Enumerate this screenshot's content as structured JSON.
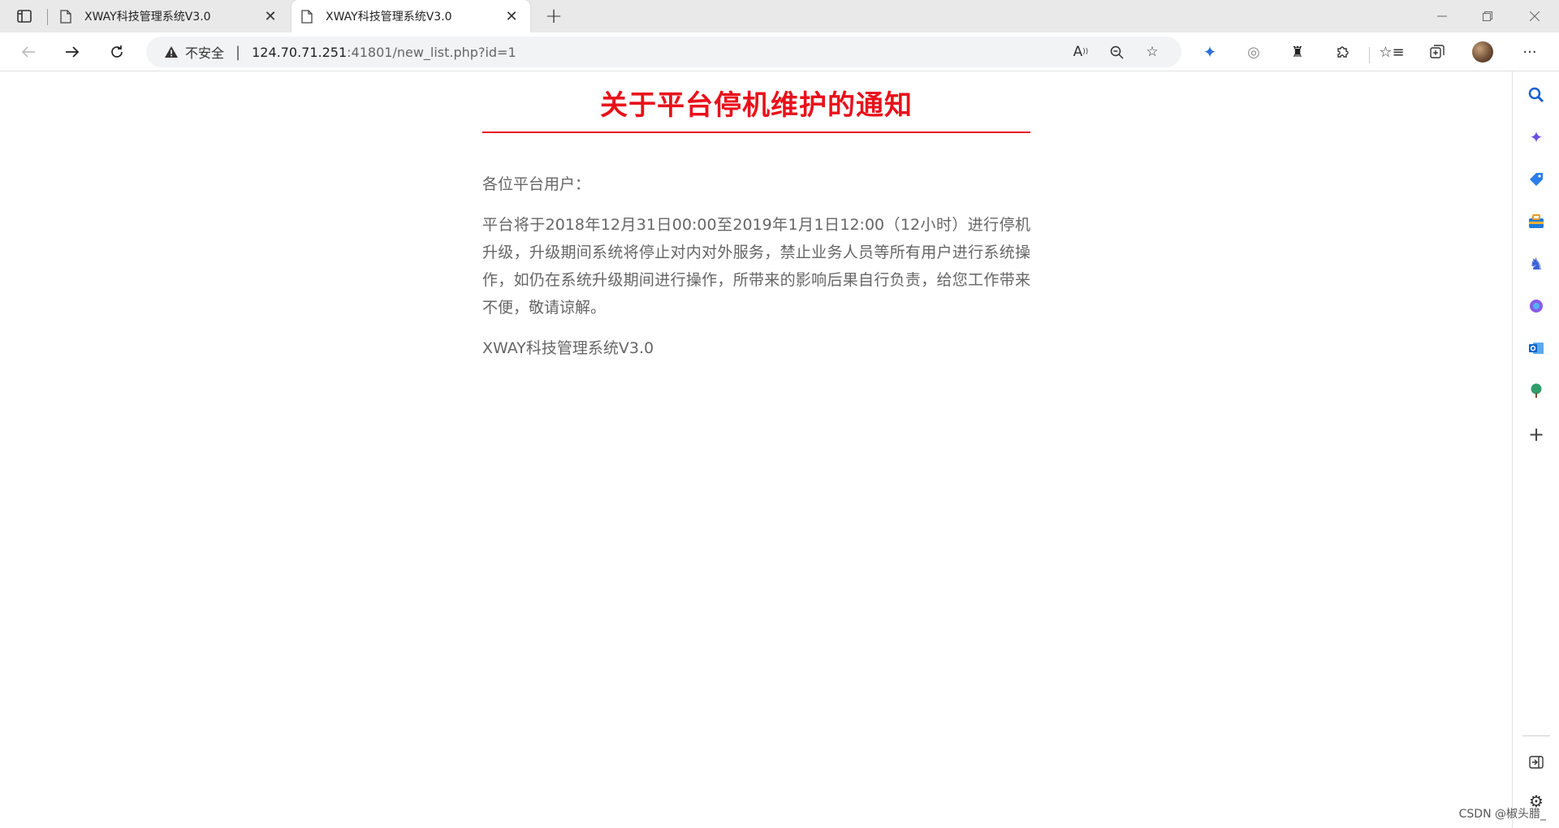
{
  "browser": {
    "tabs": [
      {
        "title": "XWAY科技管理系统V3.0",
        "active": false
      },
      {
        "title": "XWAY科技管理系统V3.0",
        "active": true
      }
    ],
    "security_label": "不安全",
    "url_host": "124.70.71.251",
    "url_rest": ":41801/new_list.php?id=1"
  },
  "icons": {
    "tab_actions": "tab-actions-icon",
    "page": "page-icon",
    "close": "close-icon",
    "new_tab": "plus-icon",
    "minimize": "minimize-icon",
    "restore": "restore-icon",
    "close_window": "close-icon",
    "back": "back-arrow-icon",
    "forward": "forward-arrow-icon",
    "refresh": "refresh-icon",
    "warning": "warning-icon",
    "read_aloud": "read-aloud-icon",
    "zoom": "zoom-out-icon",
    "favorite_add": "add-favorite-icon",
    "extensions": "puzzle-icon",
    "favorites": "favorites-icon",
    "collections": "collections-icon",
    "more": "more-icon"
  },
  "article": {
    "title": "关于平台停机维护的通知",
    "greeting": "各位平台用户：",
    "body": "平台将于2018年12月31日00:00至2019年1月1日12:00（12小时）进行停机升级，升级期间系统将停止对内对外服务，禁止业务人员等所有用户进行系统操作，如仍在系统升级期间进行操作，所带来的影响后果自行负责，给您工作带来不便，敬请谅解。",
    "signature": "XWAY科技管理系统V3.0"
  },
  "watermark": "CSDN @椒头腊_",
  "colors": {
    "title_red": "#e8111b",
    "body_text": "#666666"
  }
}
